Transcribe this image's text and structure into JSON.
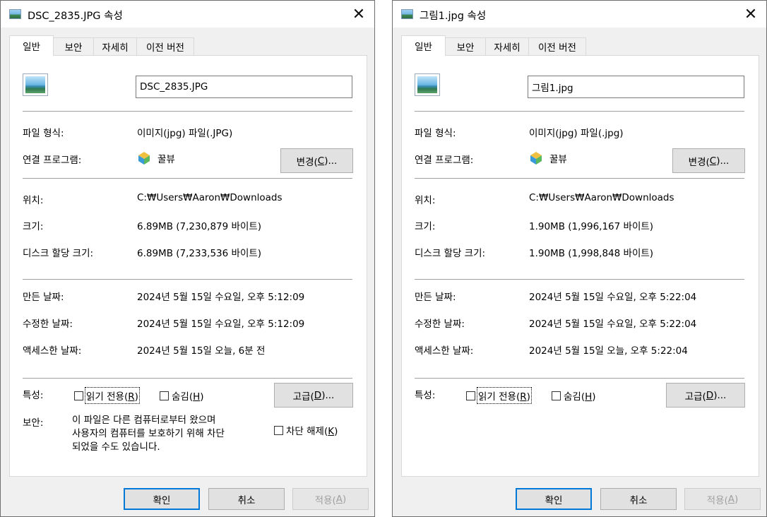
{
  "tabs": [
    "일반",
    "보안",
    "자세히",
    "이전 버전"
  ],
  "labels": {
    "type": "파일 형식:",
    "opens_with": "연결 프로그램:",
    "location": "위치:",
    "size": "크기:",
    "size_on_disk": "디스크 할당 크기:",
    "created": "만든 날짜:",
    "modified": "수정한 날짜:",
    "accessed": "액세스한 날짜:",
    "attributes": "특성:",
    "security": "보안:"
  },
  "buttons": {
    "change_pre": "변경(",
    "change_key": "C",
    "change_post": ")...",
    "advanced_pre": "고급(",
    "advanced_key": "D",
    "advanced_post": ")...",
    "ok": "확인",
    "cancel": "취소",
    "apply_pre": "적용(",
    "apply_key": "A",
    "apply_post": ")"
  },
  "checkboxes": {
    "readonly_pre": "읽기 전용(",
    "readonly_key": "R",
    "readonly_post": ")",
    "hidden_pre": "숨김(",
    "hidden_key": "H",
    "hidden_post": ")",
    "unblock_pre": "차단 해제(",
    "unblock_key": "K",
    "unblock_post": ")"
  },
  "colors": {
    "accent": "#0078d7",
    "window_bg": "#f0f0f0",
    "panel_bg": "#ffffff"
  },
  "win_a": {
    "title": "DSC_2835.JPG 속성",
    "filename": "DSC_2835.JPG",
    "type": "이미지(jpg) 파일(.JPG)",
    "app": "꿀뷰",
    "location": "C:₩Users₩Aaron₩Downloads",
    "size": "6.89MB (7,230,879 바이트)",
    "size_on_disk": "6.89MB (7,233,536 바이트)",
    "created": "2024년 5월 15일 수요일, 오후 5:12:09",
    "modified": "2024년 5월 15일 수요일, 오후 5:12:09",
    "accessed": "2024년 5월 15일 오늘, 6분 전",
    "security_lines": [
      "이 파일은 다른 컴퓨터로부터 왔으며",
      "사용자의 컴퓨터를 보호하기 위해 차단",
      "되었을 수도 있습니다."
    ]
  },
  "win_b": {
    "title": "그림1.jpg 속성",
    "filename": "그림1.jpg",
    "type": "이미지(jpg) 파일(.jpg)",
    "app": "꿀뷰",
    "location": "C:₩Users₩Aaron₩Downloads",
    "size": "1.90MB (1,996,167 바이트)",
    "size_on_disk": "1.90MB (1,998,848 바이트)",
    "created": "2024년 5월 15일 수요일, 오후 5:22:04",
    "modified": "2024년 5월 15일 수요일, 오후 5:22:04",
    "accessed": "2024년 5월 15일 오늘, 오후 5:22:04"
  }
}
